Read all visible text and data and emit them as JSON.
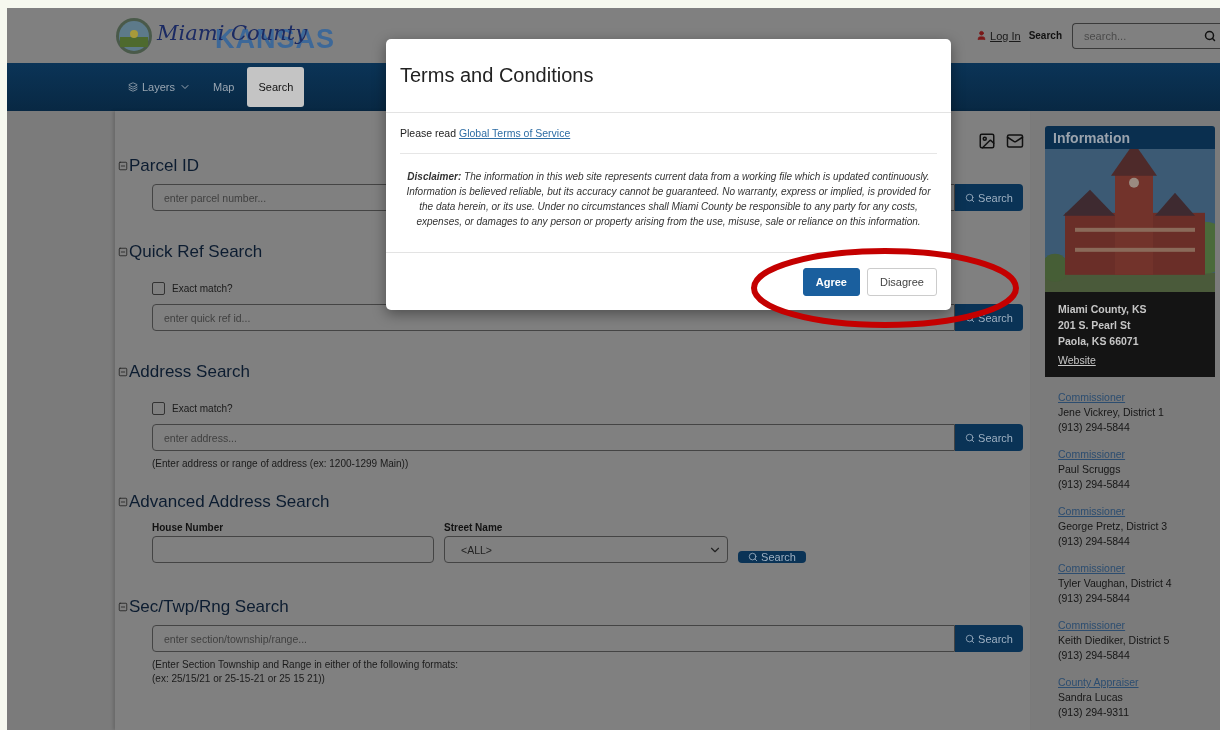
{
  "header": {
    "logo": {
      "script": "Miami County",
      "word": "KANSAS"
    },
    "login": "Log In",
    "search_label": "Search",
    "search": {
      "placeholder": "search..."
    }
  },
  "nav": [
    {
      "label": "Layers",
      "kind": "dropdown",
      "selected": false
    },
    {
      "label": "Map",
      "kind": "link",
      "selected": false
    },
    {
      "label": "Search",
      "kind": "link",
      "selected": true
    }
  ],
  "sections": [
    {
      "title": "Parcel ID",
      "kind": "simple",
      "placeholder": "enter parcel number...",
      "button": "Search"
    },
    {
      "title": "Quick Ref Search",
      "kind": "simple",
      "exact_match": {
        "label": "Exact match?",
        "checked": false
      },
      "placeholder": "enter quick ref id...",
      "button": "Search"
    },
    {
      "title": "Address Search",
      "kind": "simple",
      "exact_match": {
        "label": "Exact match?",
        "checked": false
      },
      "placeholder": "enter address...",
      "button": "Search",
      "hints": [
        "(Enter address or range of address (ex: 1200-1299 Main))"
      ]
    },
    {
      "title": "Advanced Address Search",
      "kind": "advanced",
      "house_label": "House Number",
      "street_label": "Street Name",
      "street_value": "<ALL>",
      "button": "Search"
    },
    {
      "title": "Sec/Twp/Rng Search",
      "kind": "simple",
      "placeholder": "enter section/township/range...",
      "button": "Search",
      "hints": [
        "(Enter Section Township and Range in either of the following formats:",
        "(ex: 25/15/21 or 25-15-21 or 25 15 21))"
      ]
    }
  ],
  "info": {
    "title": "Information",
    "address": [
      "Miami County, KS",
      "201 S. Pearl St",
      "Paola, KS 66071"
    ],
    "website": "Website",
    "contacts": [
      {
        "role": "Commissioner",
        "name": "Jene Vickrey, District 1",
        "phone": "(913) 294-5844"
      },
      {
        "role": "Commissioner",
        "name": "Paul Scruggs",
        "phone": "(913) 294-5844"
      },
      {
        "role": "Commissioner",
        "name": "George Pretz, District 3",
        "phone": "(913) 294-5844"
      },
      {
        "role": "Commissioner",
        "name": "Tyler Vaughan, District 4",
        "phone": "(913) 294-5844"
      },
      {
        "role": "Commissioner",
        "name": "Keith Diediker, District 5",
        "phone": "(913) 294-5844"
      },
      {
        "role": "County Appraiser",
        "name": "Sandra Lucas",
        "phone": "(913) 294-9311"
      }
    ]
  },
  "modal": {
    "title": "Terms and Conditions",
    "intro": "Please read",
    "link": "Global Terms of Service",
    "disclaimer": "**Disclaimer:** The information in this web site represents current data from a working file which is updated continuously. Information is believed reliable, but its accuracy cannot be guaranteed. No warranty, express or implied, is provided for the data herein, or its use. Under no circumstances shall Miami County be responsible to any party for any costs, expenses, or damages to any person or property arising from the use, misuse, sale or reliance on this information.",
    "buttons": [
      {
        "label": "Agree",
        "kind": "primary"
      },
      {
        "label": "Disagree",
        "kind": "secondary"
      }
    ]
  }
}
